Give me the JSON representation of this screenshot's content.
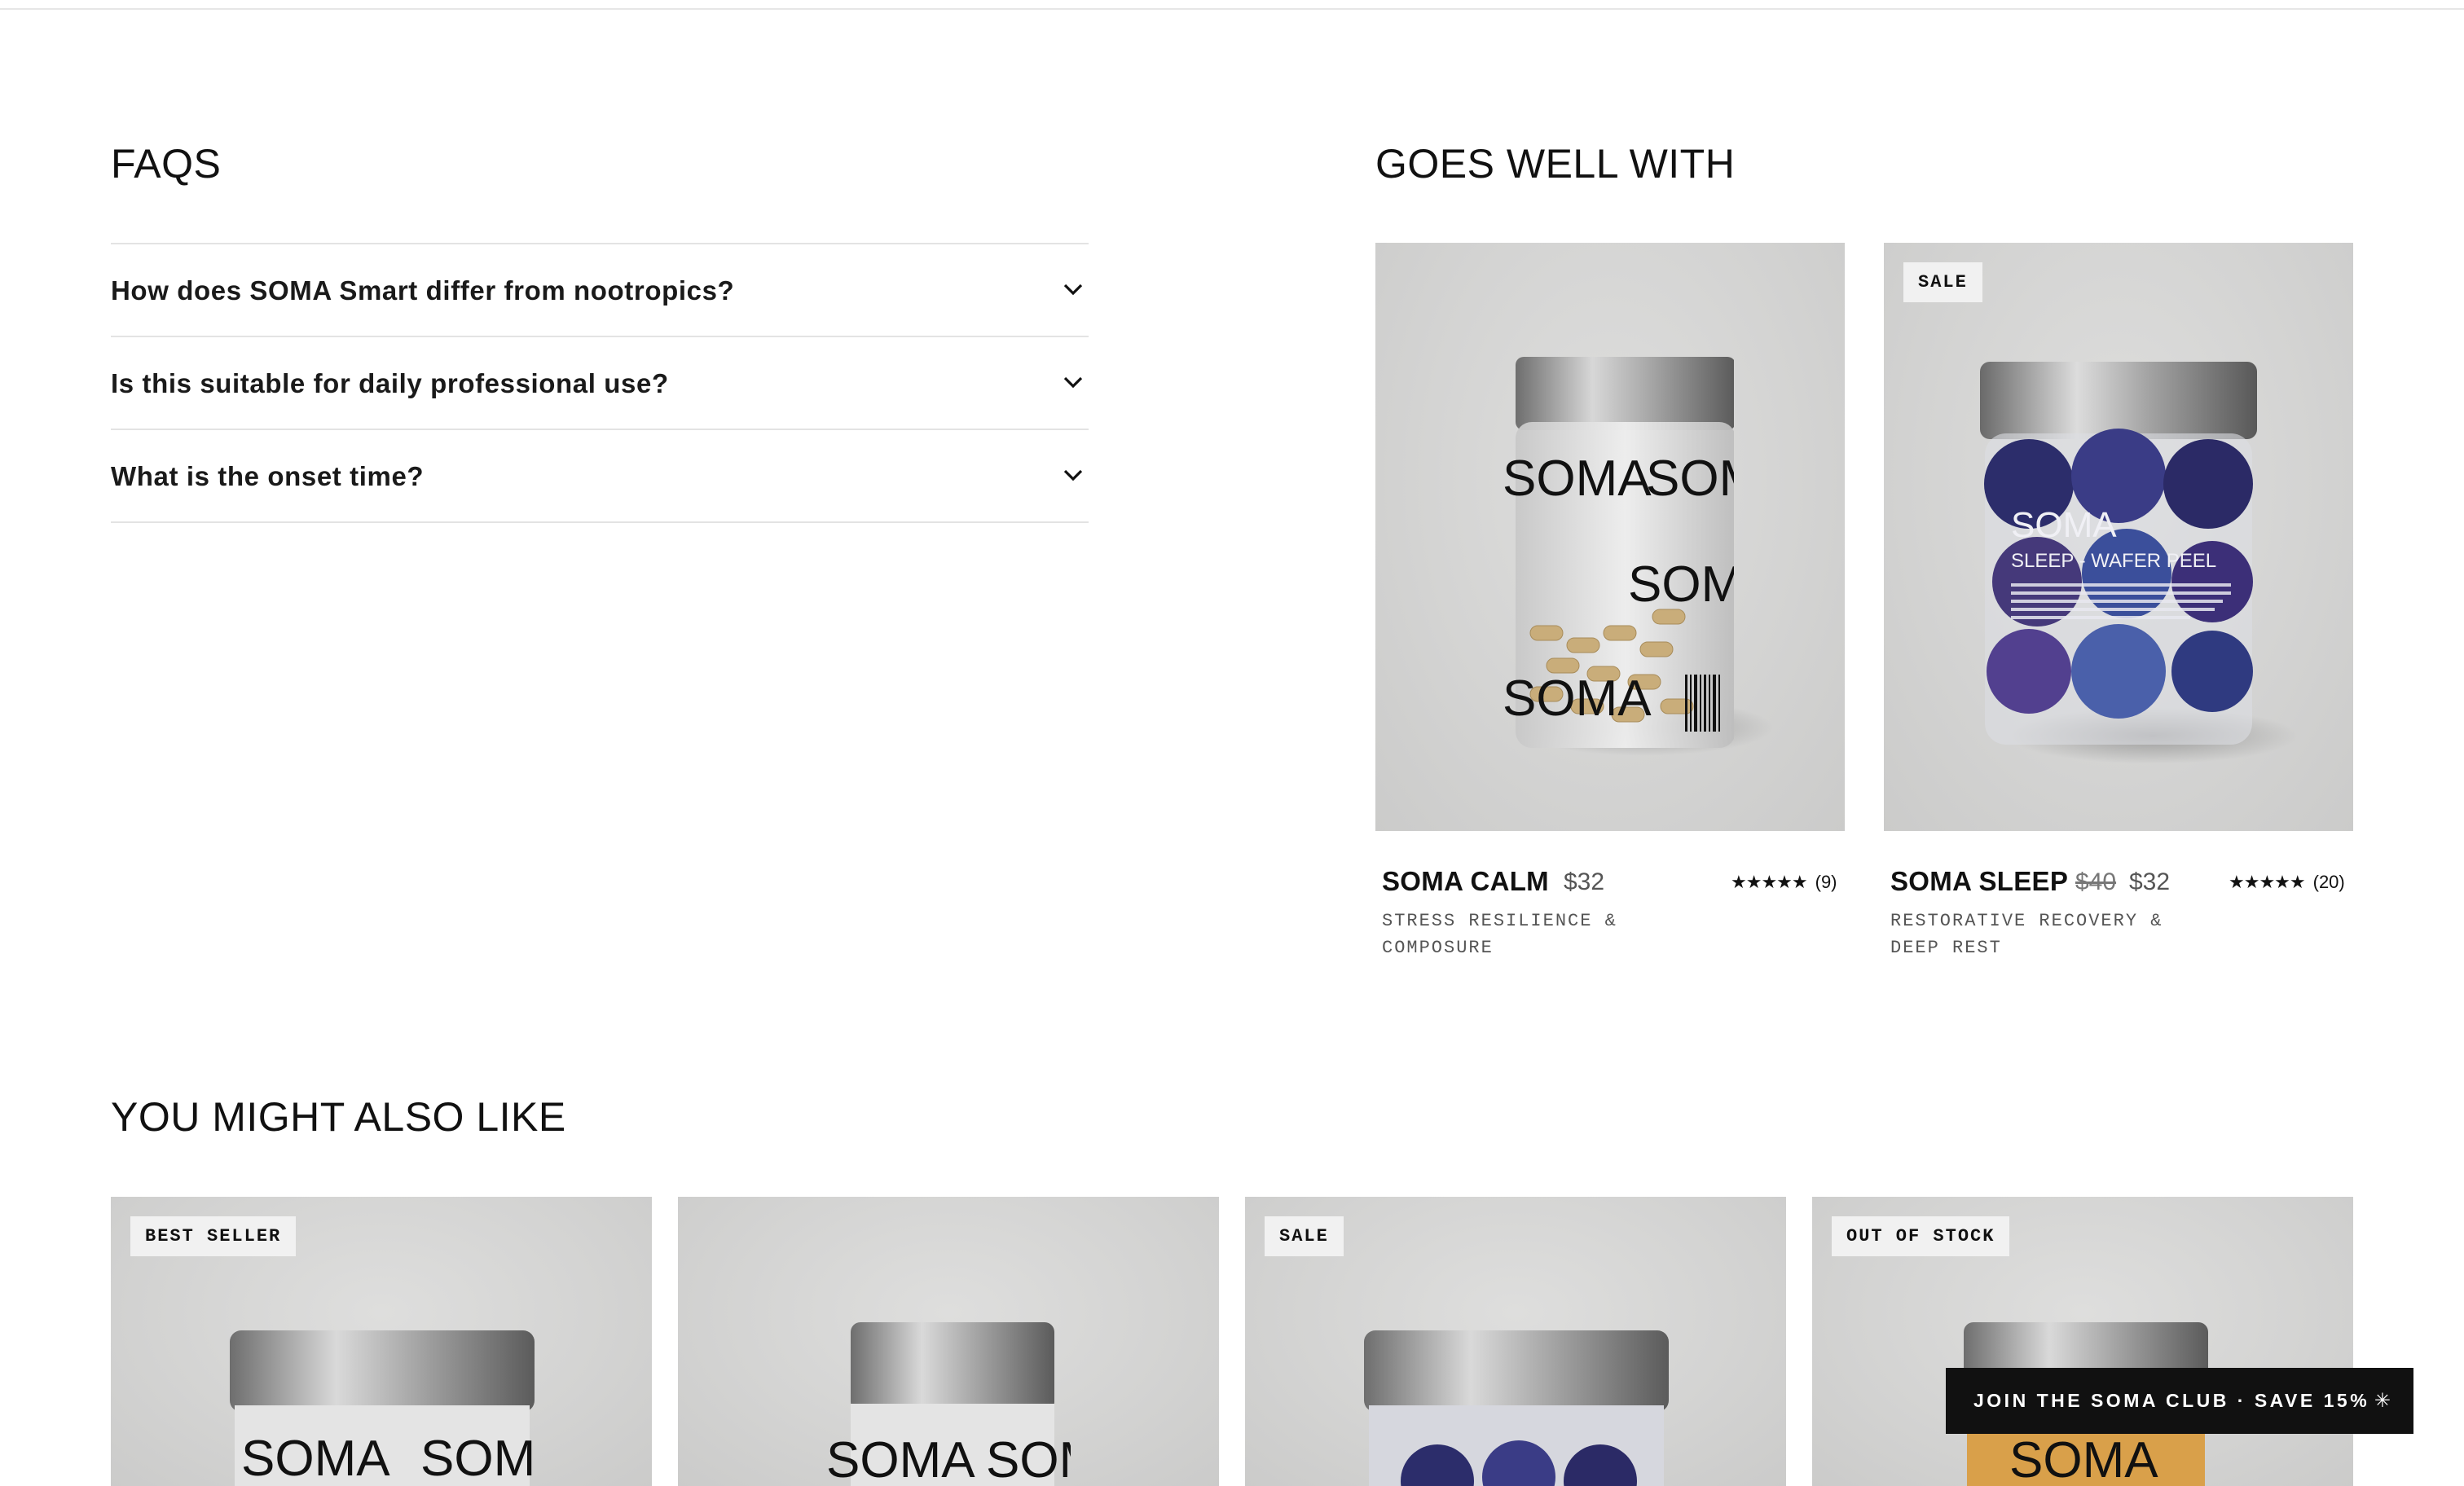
{
  "faqs": {
    "title": "FAQS",
    "items": [
      {
        "question": "How does SOMA Smart differ from nootropics?"
      },
      {
        "question": "Is this suitable for daily professional use?"
      },
      {
        "question": "What is the onset time?"
      }
    ]
  },
  "goes_well_with": {
    "title": "GOES WELL WITH",
    "products": [
      {
        "name": "SOMA CALM",
        "price": "$32",
        "old_price": "",
        "badge": "",
        "rating_stars": "★★★★★",
        "rating_count": "(9)",
        "desc": "STRESS RESILIENCE & COMPOSURE"
      },
      {
        "name": "SOMA SLEEP",
        "price": "$32",
        "old_price": "$40",
        "badge": "SALE",
        "rating_stars": "★★★★★",
        "rating_count": "(20)",
        "desc": "RESTORATIVE RECOVERY & DEEP REST"
      }
    ]
  },
  "you_might_also_like": {
    "title": "YOU MIGHT ALSO LIKE",
    "products": [
      {
        "badge": "BEST SELLER"
      },
      {
        "badge": ""
      },
      {
        "badge": "SALE"
      },
      {
        "badge": "OUT OF STOCK"
      }
    ]
  },
  "club_banner": {
    "label": "JOIN THE SOMA CLUB · SAVE 15%",
    "icon": "asterisk-icon"
  },
  "jar_text": {
    "brand": "SOMA",
    "sleep_sub": "SLEEP - WAFER PEEL"
  }
}
